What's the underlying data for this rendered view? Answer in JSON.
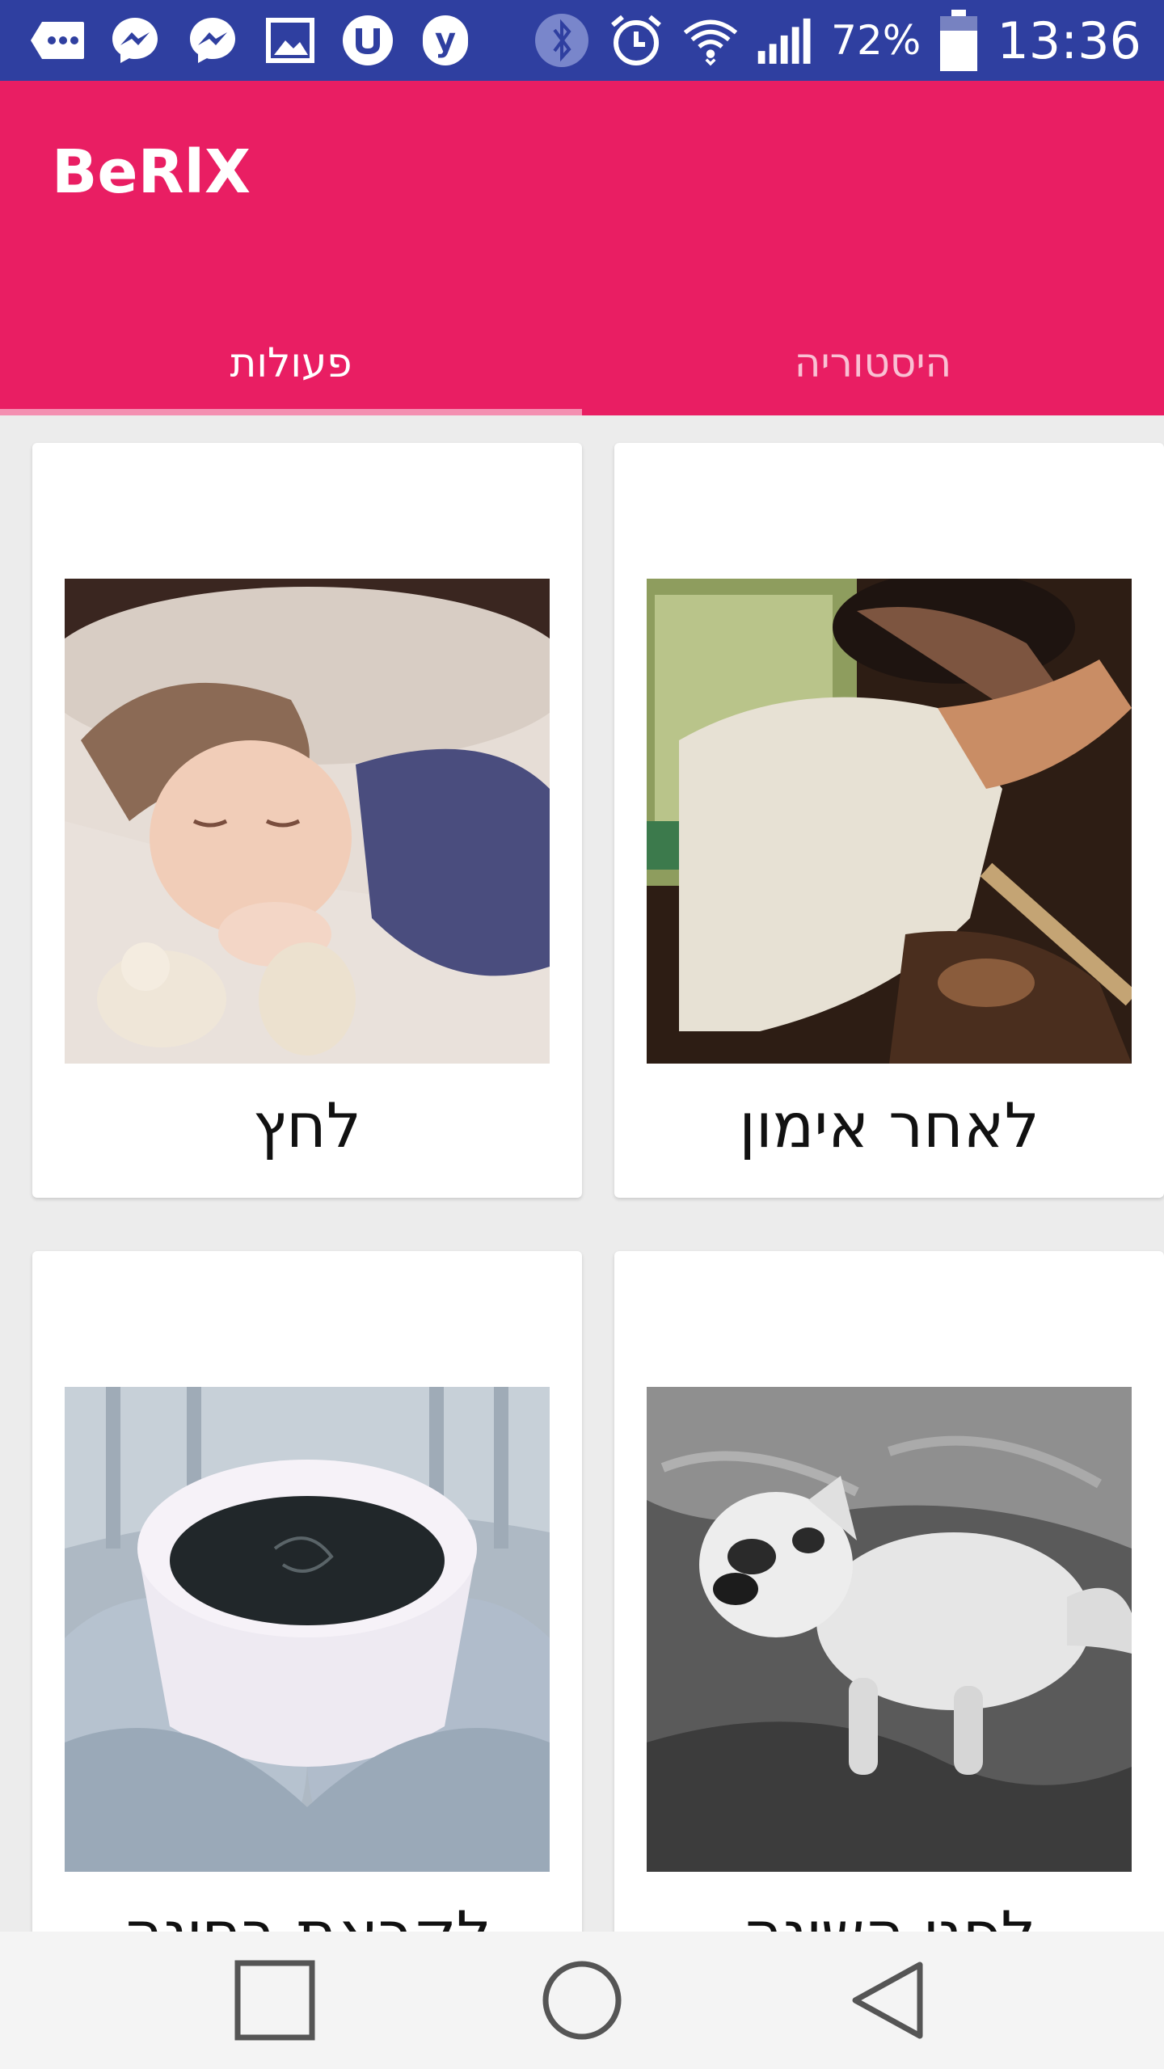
{
  "status_bar": {
    "icons_left": [
      "more-notifications-icon",
      "messenger-icon",
      "messenger-icon",
      "gallery-icon",
      "utorrent-icon",
      "yandex-icon"
    ],
    "icons_right": [
      "bluetooth-icon",
      "alarm-icon",
      "wifi-icon",
      "signal-icon",
      "battery-icon"
    ],
    "battery": "72%",
    "time": "13:36"
  },
  "app": {
    "title": "BeRlX"
  },
  "tabs": [
    {
      "label": "פעולות",
      "active": true
    },
    {
      "label": "היסטוריה",
      "active": false
    }
  ],
  "cards": [
    {
      "label": "לחץ",
      "image": "sleeping-child"
    },
    {
      "label": "לאחר אימון",
      "image": "sleeping-man-in-car"
    },
    {
      "label": "לקראת בחינה",
      "image": "coffee-cup-in-mittens"
    },
    {
      "label": "לפני השינה",
      "image": "sleeping-bulldog"
    }
  ],
  "navbar": {
    "buttons": [
      "recents-button",
      "home-button",
      "back-button"
    ]
  },
  "colors": {
    "status_bar": "#2f3fa0",
    "accent": "#e91e63",
    "tab_indicator": "#f48fb1",
    "background": "#ececec"
  }
}
